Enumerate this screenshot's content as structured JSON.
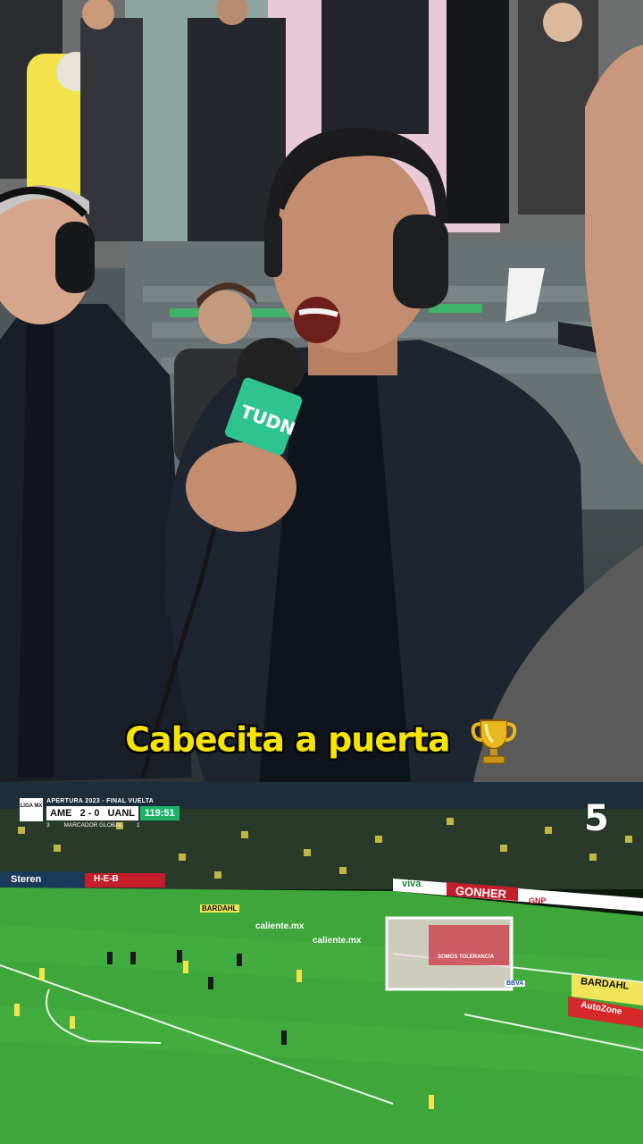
{
  "caption": {
    "text": "Cabecita a puerta",
    "emoji": "trophy"
  },
  "microphone": {
    "brand": "TUDN",
    "brand_color": "#2fc48f"
  },
  "scorebug": {
    "league_logo": "LIGA MX",
    "competition": "APERTURA 2023 - FINAL VUELTA",
    "home_team": "AME",
    "score": "2 - 0",
    "away_team": "UANL",
    "clock": "119:51",
    "aggregate_left": "3",
    "aggregate_label": "MARCADOR GLOBAL",
    "aggregate_right": "1"
  },
  "channel_logo": "5",
  "ads": {
    "steren": "Steren",
    "heb": "H-E-B",
    "bardahl": "BARDAHL",
    "caliente": "caliente.mx",
    "gonher": "GONHER",
    "gnp": "GNP",
    "viva": "viva",
    "bbva": "BBVA",
    "somos_tolerancia": "SOMOS TOLERANCIA",
    "autozone": "AutoZone"
  },
  "colors": {
    "caption_yellow": "#f5e400",
    "pitch_green": "#3ea63a",
    "america_yellow": "#f2e34a",
    "clock_green": "#1db46a"
  }
}
